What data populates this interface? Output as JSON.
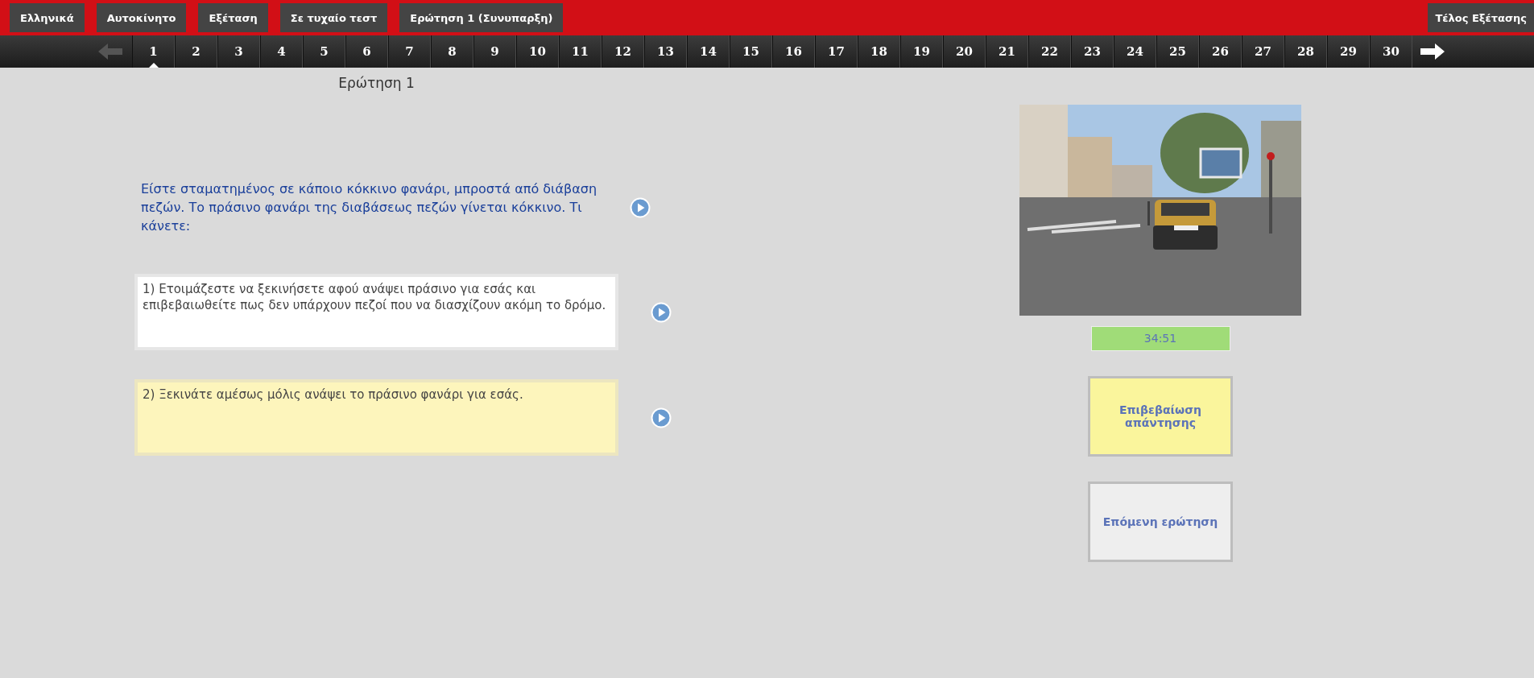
{
  "top_bar": {
    "buttons": [
      "Ελληνικά",
      "Αυτοκίνητο",
      "Εξέταση",
      "Σε τυχαίο τεστ",
      "Ερώτηση 1 (Συνυπαρξη)"
    ],
    "end_button": "Τέλος Εξέτασης"
  },
  "nav": {
    "prev": {
      "disabled": true
    },
    "next": {
      "disabled": false
    },
    "items": [
      {
        "label": "1",
        "selected": true
      },
      {
        "label": "2",
        "selected": false
      },
      {
        "label": "3",
        "selected": false
      },
      {
        "label": "4",
        "selected": false
      },
      {
        "label": "5",
        "selected": false
      },
      {
        "label": "6",
        "selected": false
      },
      {
        "label": "7",
        "selected": false
      },
      {
        "label": "8",
        "selected": false
      },
      {
        "label": "9",
        "selected": false
      },
      {
        "label": "10",
        "selected": false
      },
      {
        "label": "11",
        "selected": false
      },
      {
        "label": "12",
        "selected": false
      },
      {
        "label": "13",
        "selected": false
      },
      {
        "label": "14",
        "selected": false
      },
      {
        "label": "15",
        "selected": false
      },
      {
        "label": "16",
        "selected": false
      },
      {
        "label": "17",
        "selected": false
      },
      {
        "label": "18",
        "selected": false
      },
      {
        "label": "19",
        "selected": false
      },
      {
        "label": "20",
        "selected": false
      },
      {
        "label": "21",
        "selected": false
      },
      {
        "label": "22",
        "selected": false
      },
      {
        "label": "23",
        "selected": false
      },
      {
        "label": "24",
        "selected": false
      },
      {
        "label": "25",
        "selected": false
      },
      {
        "label": "26",
        "selected": false
      },
      {
        "label": "27",
        "selected": false
      },
      {
        "label": "28",
        "selected": false
      },
      {
        "label": "29",
        "selected": false
      },
      {
        "label": "30",
        "selected": false
      }
    ]
  },
  "question": {
    "title": "Ερώτηση 1",
    "text": "Είστε σταματημένος σε κάποιο κόκκινο φανάρι, μπροστά από διάβαση πεζών. Το πράσινο φανάρι της διαβάσεως πεζών γίνεται κόκκινο. Τι κάνετε:",
    "answers": [
      {
        "text": "1) Ετοιμάζεστε να ξεκινήσετε αφού ανάψει πράσινο για εσάς και επιβεβαιωθείτε πως δεν υπάρχουν πεζοί που να διασχίζουν ακόμη το δρόμο.",
        "selected": false
      },
      {
        "text": "2) Ξεκινάτε αμέσως μόλις ανάψει το πράσινο φανάρι για εσάς.",
        "selected": true
      }
    ]
  },
  "side": {
    "timer": "34:51",
    "confirm_button": "Επιβεβαίωση απάντησης",
    "next_button": "Επόμενη ερώτηση"
  }
}
